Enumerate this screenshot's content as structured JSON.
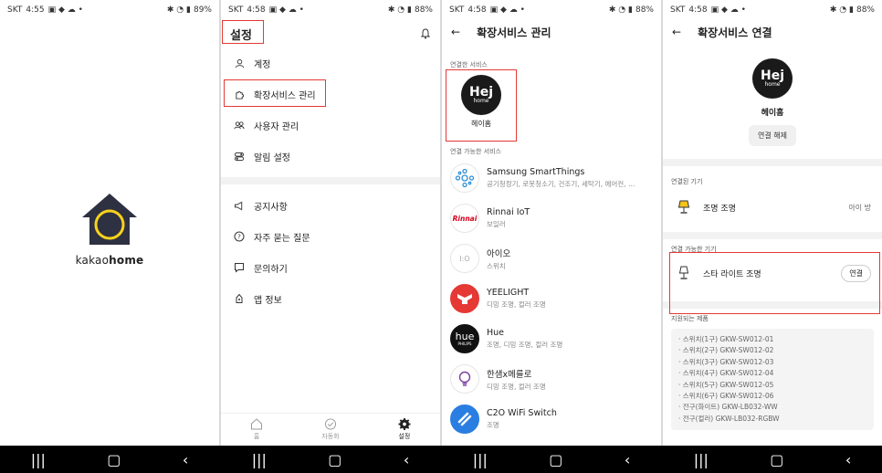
{
  "panel1": {
    "status": {
      "carrier": "SKT",
      "time": "4:55",
      "battery": "89%"
    },
    "brand_light": "kakao",
    "brand_bold": "home",
    "colors": {
      "house": "#2e3142",
      "circle": "#f7d21b"
    }
  },
  "panel2": {
    "status": {
      "carrier": "SKT",
      "time": "4:58",
      "battery": "88%"
    },
    "title": "설정",
    "menu_group1": [
      {
        "icon": "person-icon",
        "label": "계정"
      },
      {
        "icon": "puzzle-icon",
        "label": "확장서비스 관리"
      },
      {
        "icon": "users-icon",
        "label": "사용자 관리"
      },
      {
        "icon": "toggle-icon",
        "label": "알림 설정"
      }
    ],
    "menu_group2": [
      {
        "icon": "megaphone-icon",
        "label": "공지사항"
      },
      {
        "icon": "question-icon",
        "label": "자주 묻는 질문"
      },
      {
        "icon": "chat-icon",
        "label": "문의하기"
      },
      {
        "icon": "info-icon",
        "label": "앱 정보"
      }
    ],
    "tabs": [
      {
        "icon": "home-icon",
        "label": "홈"
      },
      {
        "icon": "check-circle-icon",
        "label": "자동화"
      },
      {
        "icon": "gear-icon",
        "label": "설정"
      }
    ]
  },
  "panel3": {
    "status": {
      "carrier": "SKT",
      "time": "4:58",
      "battery": "88%"
    },
    "title": "확장서비스 관리",
    "connected_label": "연결한 서비스",
    "connected": {
      "logo_big": "Hej",
      "logo_small": "home",
      "name": "헤이홈"
    },
    "available_label": "연결 가능한 서비스",
    "services": [
      {
        "name": "Samsung SmartThings",
        "desc": "공기청정기, 로봇청소기, 건조기, 세탁기, 에어컨, …",
        "logo": "smartthings-icon",
        "bg": "#ffffff",
        "fg": "#2f8fd5"
      },
      {
        "name": "Rinnai IoT",
        "desc": "보일러",
        "logo": "rinnai-icon",
        "logo_text": "Rinnai",
        "bg": "#ffffff",
        "fg": "#d6001c"
      },
      {
        "name": "아이오",
        "desc": "스위치",
        "logo": "io-icon",
        "logo_text": "I:O",
        "bg": "#ffffff",
        "fg": "#aaaaaa"
      },
      {
        "name": "YEELIGHT",
        "desc": "디밍 조명, 컬러 조명",
        "logo": "yeelight-icon",
        "bg": "#e53935",
        "fg": "#ffffff"
      },
      {
        "name": "Hue",
        "desc": "조명, 디밍 조명, 컬러 조명",
        "logo": "hue-icon",
        "logo_text": "hue",
        "logo_sub": "PHILIPS",
        "bg": "#111111",
        "fg": "#ffffff"
      },
      {
        "name": "한샘x메를로",
        "desc": "디밍 조명, 컬러 조명",
        "logo": "bulb-icon",
        "bg": "#ffffff",
        "fg": "#7b3fa0"
      },
      {
        "name": "C2O WiFi Switch",
        "desc": "조명",
        "logo": "c2o-icon",
        "bg": "#2a7de1",
        "fg": "#ffffff"
      }
    ]
  },
  "panel4": {
    "status": {
      "carrier": "SKT",
      "time": "4:58",
      "battery": "88%"
    },
    "title": "확장서비스 연결",
    "logo_big": "Hej",
    "logo_small": "home",
    "service_name": "헤이홈",
    "disconnect_label": "연결 해제",
    "connected_devices_label": "연결된 기기",
    "connected_device": {
      "name": "조명 조명",
      "room": "아이 방"
    },
    "available_devices_label": "연결 가능한 기기",
    "available_device": {
      "name": "스타 라이트 조명",
      "button": "연결"
    },
    "supported_label": "지원되는 제품",
    "supported": [
      "· 스위치(1구)   GKW-SW012-01",
      "· 스위치(2구)   GKW-SW012-02",
      "· 스위치(3구)   GKW-SW012-03",
      "· 스위치(4구)   GKW-SW012-04",
      "· 스위치(5구)   GKW-SW012-05",
      "· 스위치(6구)   GKW-SW012-06",
      "· 전구(화이트)   GKW-LB032-WW",
      "· 전구(컬러)   GKW-LB032-RGBW"
    ]
  },
  "accent_red": "#e53935"
}
